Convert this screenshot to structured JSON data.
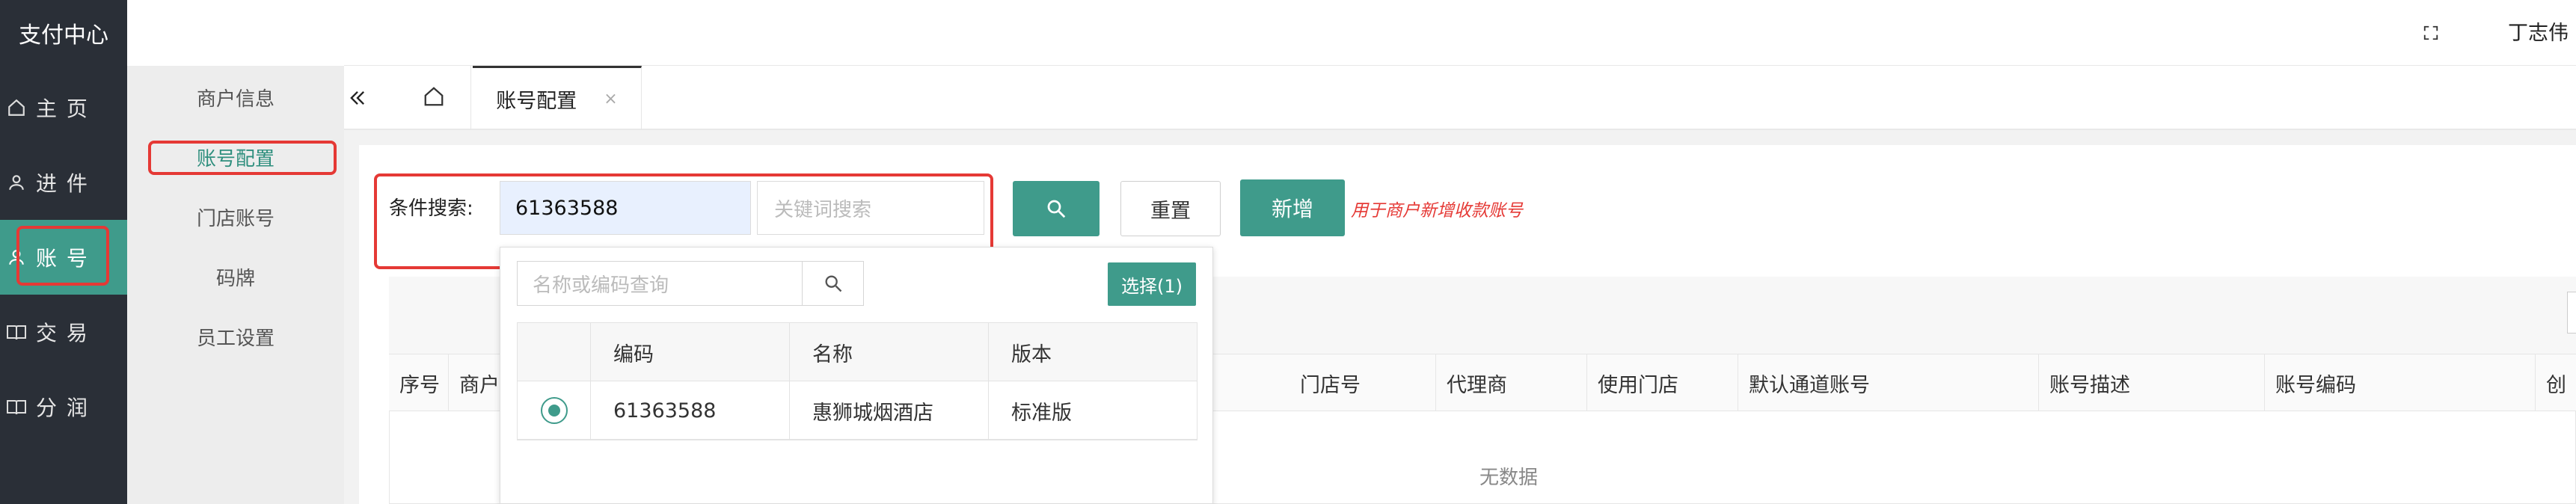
{
  "app": {
    "title": "支付中心",
    "user": "丁志伟"
  },
  "sidebar": {
    "items": [
      {
        "label": "主 页",
        "icon": "home-icon"
      },
      {
        "label": "进 件",
        "icon": "user-icon"
      },
      {
        "label": "账 号",
        "icon": "user-icon",
        "active": true
      },
      {
        "label": "交 易",
        "icon": "book-icon"
      },
      {
        "label": "分 润",
        "icon": "book-icon"
      }
    ]
  },
  "submenu": {
    "items": [
      {
        "label": "商户信息"
      },
      {
        "label": "账号配置",
        "active": true
      },
      {
        "label": "门店账号"
      },
      {
        "label": "码牌"
      },
      {
        "label": "员工设置"
      }
    ]
  },
  "tabs": {
    "active_label": "账号配置",
    "close": "×"
  },
  "search": {
    "label": "条件搜索:",
    "code_value": "61363588",
    "keyword_placeholder": "关键词搜索",
    "reset_label": "重置",
    "add_label": "新增",
    "hint": "用于商户新增收款账号"
  },
  "table": {
    "columns": [
      "序号",
      "商户",
      "门店号",
      "代理商",
      "使用门店",
      "默认通道账号",
      "账号描述",
      "账号编码",
      "创"
    ],
    "empty_text": "无数据"
  },
  "popup": {
    "search_placeholder": "名称或编码查询",
    "choose_label": "选择(1)",
    "columns": [
      "编码",
      "名称",
      "版本"
    ],
    "rows": [
      {
        "code": "61363588",
        "name": "惠狮城烟酒店",
        "version": "标准版",
        "selected": true
      }
    ]
  },
  "colors": {
    "accent": "#3f9b8b",
    "sidebar_bg": "#2a2f37",
    "highlight_red": "#e53935"
  }
}
